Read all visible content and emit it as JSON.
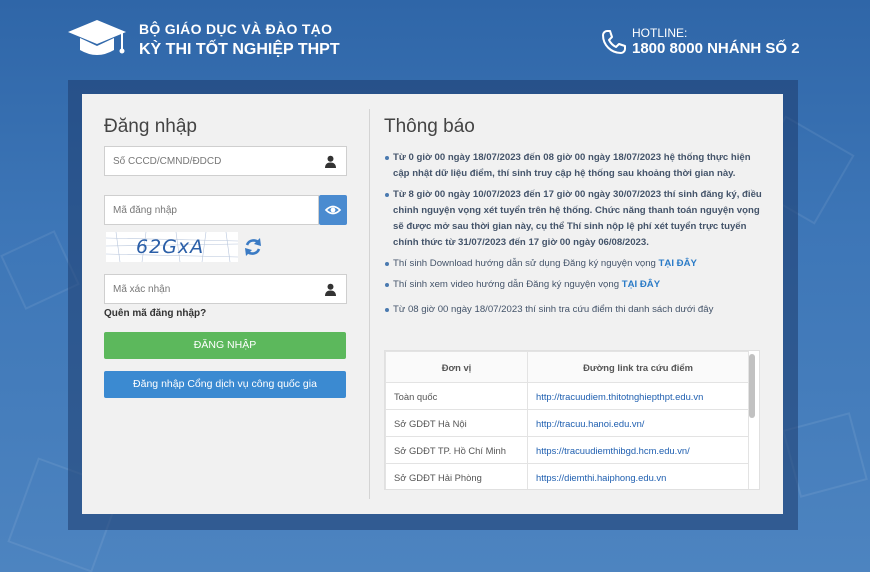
{
  "header": {
    "org_line1": "BỘ GIÁO DỤC VÀ ĐÀO TẠO",
    "org_line2": "KỲ THI TỐT NGHIỆP THPT",
    "hotline_label": "HOTLINE:",
    "hotline_number": "1800 8000 NHÁNH SỐ 2"
  },
  "login": {
    "title": "Đăng nhập",
    "id_placeholder": "Số CCCD/CMND/ĐDCD",
    "password_placeholder": "Mã đăng nhập",
    "captcha_text": "62GxA",
    "captcha_placeholder": "Mã xác nhận",
    "forgot": "Quên mã đăng nhập?",
    "login_button": "ĐĂNG NHẬP",
    "portal_button": "Đăng nhập Cổng dịch vụ công quốc gia"
  },
  "notice": {
    "title": "Thông báo",
    "items": [
      {
        "text": "Từ 0 giờ 00 ngày 18/07/2023 đến 08 giờ 00 ngày 18/07/2023 hệ thống thực hiện cập nhật dữ liệu điểm, thí sinh truy cập hệ thống sau khoảng thời gian này."
      },
      {
        "text": "Từ 8 giờ 00 ngày 10/07/2023 đến 17 giờ 00 ngày 30/07/2023 thí sinh đăng ký, điều chỉnh nguyện vọng xét tuyển trên hệ thống. Chức năng thanh toán nguyện vọng sẽ được mở sau thời gian này, cụ thể Thí sinh nộp lệ phí xét tuyển trực tuyến chính thức từ 31/07/2023 đến 17 giờ 00 ngày 06/08/2023."
      },
      {
        "text": "Thí sinh Download hướng dẫn sử dụng Đăng ký nguyện vọng ",
        "link": "TẠI ĐÂY"
      },
      {
        "text": "Thí sinh xem video hướng dẫn Đăng ký nguyện vọng ",
        "link": "TẠI ĐÂY"
      },
      {
        "text": "Từ 08 giờ 00 ngày 18/07/2023 thí sinh tra cứu điểm thi danh sách dưới đây"
      }
    ],
    "table": {
      "headers": [
        "Đơn vị",
        "Đường link tra cứu điểm"
      ],
      "rows": [
        [
          "Toàn quốc",
          "http://tracuudiem.thitotnghiepthpt.edu.vn"
        ],
        [
          "Sở GDĐT Hà Nội",
          "http://tracuu.hanoi.edu.vn/"
        ],
        [
          "Sở GDĐT TP. Hồ Chí Minh",
          "https://tracuudiemthibgd.hcm.edu.vn/"
        ],
        [
          "Sở GDĐT Hải Phòng",
          "https://diemthi.haiphong.edu.vn"
        ]
      ]
    }
  },
  "colors": {
    "background": "#3d76b7",
    "login_button": "#5cb85c",
    "portal_button": "#3b8ad1",
    "link": "#2a7bc7"
  },
  "icons": [
    "graduation-cap-icon",
    "phone-icon",
    "user-icon",
    "eye-icon",
    "refresh-icon"
  ]
}
